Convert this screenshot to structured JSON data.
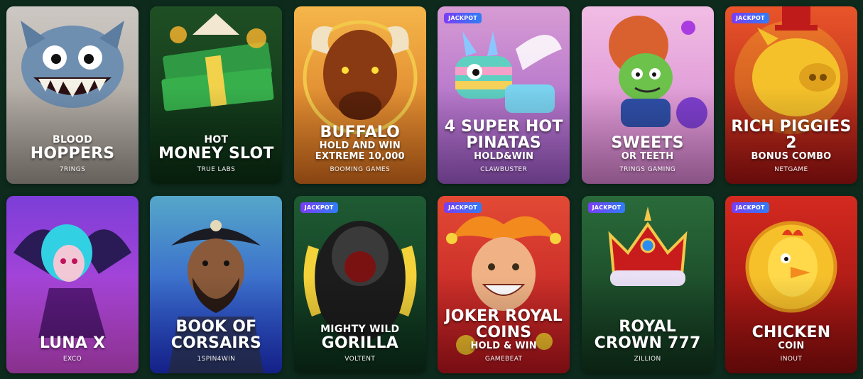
{
  "badge_label": "JACKPOT",
  "games": [
    {
      "line1": "BLOOD",
      "line2": "HOPPERS",
      "line3": "",
      "provider": "7RINGS",
      "jackpot": false,
      "bg": [
        "#cdc8c3",
        "#9d958d"
      ],
      "icon": "monster-icon"
    },
    {
      "line1": "HOT",
      "line2": "MONEY SLOT",
      "line3": "",
      "provider": "TRUE LABS",
      "jackpot": false,
      "bg": [
        "#1f4f24",
        "#0b2d14"
      ],
      "icon": "cash-stack-icon"
    },
    {
      "line1": "",
      "line2": "BUFFALO",
      "line3": "HOLD AND WIN EXTREME 10,000",
      "provider": "BOOMING GAMES",
      "jackpot": false,
      "bg": [
        "#f5b64a",
        "#d16a1c"
      ],
      "icon": "buffalo-icon"
    },
    {
      "line1": "",
      "line2": "4 SUPER HOT PINATAS",
      "line3": "HOLD&WIN",
      "provider": "CLAWBUSTER",
      "jackpot": true,
      "bg": [
        "#d79bd4",
        "#9a58c4"
      ],
      "icon": "pinata-icon"
    },
    {
      "line1": "",
      "line2": "SWEETS",
      "line3": "OR TEETH",
      "provider": "7RINGS GAMING",
      "jackpot": false,
      "bg": [
        "#f1bde5",
        "#d27fcb"
      ],
      "icon": "goblin-icon"
    },
    {
      "line1": "",
      "line2": "RICH PIGGIES 2",
      "line3": "BONUS COMBO",
      "provider": "NETGAME",
      "jackpot": true,
      "bg": [
        "#e9552a",
        "#9d1212"
      ],
      "icon": "gold-pig-icon"
    },
    {
      "line1": "",
      "line2": "LUNA X",
      "line3": "",
      "provider": "EXCO",
      "jackpot": false,
      "bg": [
        "#7c3ed8",
        "#d04ad7"
      ],
      "icon": "vampire-girl-icon"
    },
    {
      "line1": "",
      "line2": "BOOK OF CORSAIRS",
      "line3": "",
      "provider": "1SPIN4WIN",
      "jackpot": false,
      "bg": [
        "#55a7c9",
        "#1f33cf"
      ],
      "icon": "pirate-icon"
    },
    {
      "line1": "MIGHTY WILD",
      "line2": "GORILLA",
      "line3": "",
      "provider": "VOLTENT",
      "jackpot": true,
      "bg": [
        "#1f5b33",
        "#0b2e1a"
      ],
      "icon": "gorilla-icon"
    },
    {
      "line1": "",
      "line2": "JOKER ROYAL COINS",
      "line3": "HOLD & WIN",
      "provider": "GAMEBEAT",
      "jackpot": true,
      "bg": [
        "#e34a35",
        "#b5141d"
      ],
      "icon": "joker-icon"
    },
    {
      "line1": "",
      "line2": "ROYAL CROWN 777",
      "line3": "",
      "provider": "ZILLION",
      "jackpot": true,
      "bg": [
        "#2a6b3a",
        "#11341d"
      ],
      "icon": "crown-icon"
    },
    {
      "line1": "",
      "line2": "CHICKEN",
      "line3": "COIN",
      "provider": "INOUT",
      "jackpot": true,
      "bg": [
        "#d42a20",
        "#8d0d0d"
      ],
      "icon": "chicken-coin-icon"
    }
  ]
}
